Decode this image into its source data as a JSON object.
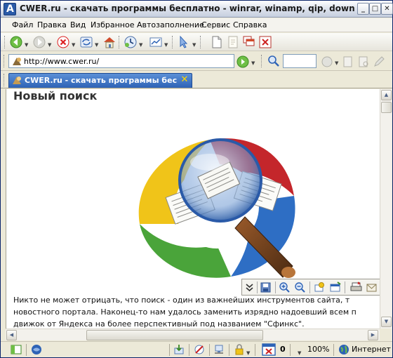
{
  "window": {
    "title": "CWER.ru - скачать программы бесплатно - winrar, winamp, qip, download master, ...",
    "minimize_glyph": "_",
    "maximize_glyph": "□",
    "close_glyph": "✕"
  },
  "menu": {
    "items": [
      "Файл",
      "Правка",
      "Вид",
      "Избранное",
      "Автозаполнение",
      "Сервис",
      "Справка"
    ]
  },
  "toolbar": {
    "icons": [
      "back-icon",
      "forward-icon",
      "stop-icon",
      "refresh-icon",
      "home-icon",
      "history-icon",
      "print-preview-icon",
      "pointer-icon",
      "new-page-icon",
      "blank-page-icon",
      "cascade-icon",
      "close-window-icon"
    ]
  },
  "address": {
    "url": "http://www.cwer.ru/",
    "search_value": ""
  },
  "tab": {
    "label": "CWER.ru - скачать программы бесплат...",
    "close_glyph": "✕"
  },
  "page": {
    "heading": "Новый поиск",
    "paragraph_lines": [
      "Никто не может отрицать, что поиск - один из важнейших инструментов сайта, т",
      "новостного портала. Наконец-то нам удалось заменить изрядно надоевший всем п",
      "движок от Яндекса на более перспективный под названием \"Сфинкс\"."
    ]
  },
  "status": {
    "counter": "0",
    "zoom": "100%",
    "zone": "Интернет"
  },
  "colors": {
    "accent": "#2e63b6",
    "frame": "#ece9d8",
    "tab_close": "#ffd800"
  }
}
